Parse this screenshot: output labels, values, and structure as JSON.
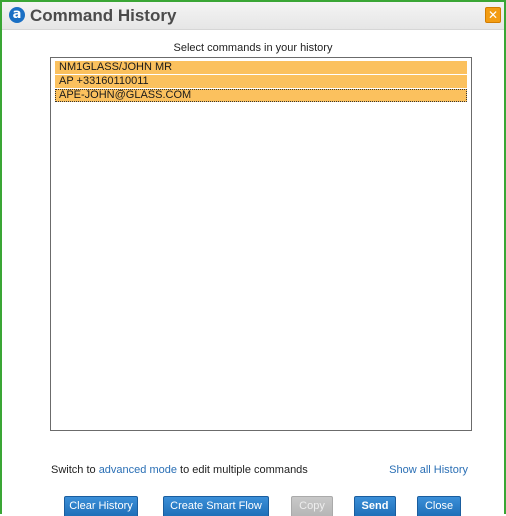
{
  "dialog": {
    "title": "Command History",
    "logo_letter": "a"
  },
  "subtitle": "Select commands in your history",
  "history": [
    "NM1GLASS/JOHN MR",
    "AP +33160110011",
    "APE-JOHN@GLASS.COM"
  ],
  "footer": {
    "prefix": "Switch to ",
    "link": "advanced mode",
    "suffix": " to edit multiple commands",
    "show_all": "Show all History"
  },
  "buttons": {
    "clear": "Clear History",
    "smart_flow": "Create Smart Flow",
    "copy": "Copy",
    "send": "Send",
    "close": "Close"
  },
  "colors": {
    "accent_border": "#3aa635",
    "selected_row": "#fbc15e",
    "button_blue": "#2a7cc9",
    "close_x": "#f39c12"
  }
}
